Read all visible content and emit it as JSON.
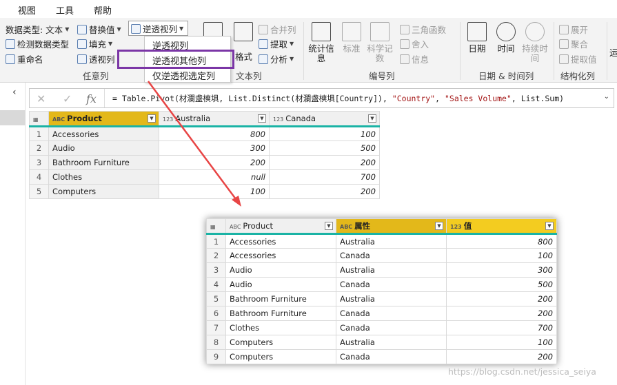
{
  "menubar": {
    "items": [
      "视图",
      "工具",
      "帮助"
    ]
  },
  "ribbon": {
    "datatype_label": "数据类型: 文本",
    "detect_label": "检测数据类型",
    "rename_label": "重命名",
    "replace_label": "替换值",
    "fill_label": "填充",
    "pivot_label": "透视列",
    "unpivot_label": "逆透视列",
    "any_column_group": "任意列",
    "merge_label": "合并列",
    "extract_label": "提取",
    "parse_label": "分析",
    "text_group": "文本列",
    "format_label": "格式",
    "stats_label": "统计信息",
    "standard_label": "标准",
    "science_label": "科学记数",
    "trig_label": "三角函数",
    "round_label": "舍入",
    "info_label": "信息",
    "number_group": "编号列",
    "date_label": "日期",
    "time_label": "时间",
    "duration_label": "持续时间",
    "datetime_group": "日期 & 时间列",
    "expand_label": "展开",
    "aggregate_label": "聚合",
    "extract_values_label": "提取值",
    "structured_group": "结构化列",
    "last_cut_label": "运"
  },
  "dropdown": {
    "items": [
      "逆透视列",
      "逆透视其他列",
      "仅逆透视选定列"
    ]
  },
  "formula": {
    "prefix": "= Table.Pivot(材瀾盏樉埧, List.Distinct(材瀾盏樉埧[Country]), ",
    "str1": "\"Country\"",
    "mid": ", ",
    "str2": "\"Sales Volume\"",
    "suffix": ", List.Sum)"
  },
  "table1": {
    "headers": [
      "Product",
      "Australia",
      "Canada"
    ],
    "types": [
      "ABC",
      "123",
      "123"
    ],
    "rows": [
      [
        "1",
        "Accessories",
        "800",
        "100"
      ],
      [
        "2",
        "Audio",
        "300",
        "500"
      ],
      [
        "3",
        "Bathroom Furniture",
        "200",
        "200"
      ],
      [
        "4",
        "Clothes",
        "null",
        "700"
      ],
      [
        "5",
        "Computers",
        "100",
        "200"
      ]
    ]
  },
  "table2": {
    "headers": [
      "Product",
      "属性",
      "值"
    ],
    "types": [
      "ABC",
      "ABC",
      "123"
    ],
    "rows": [
      [
        "1",
        "Accessories",
        "Australia",
        "800"
      ],
      [
        "2",
        "Accessories",
        "Canada",
        "100"
      ],
      [
        "3",
        "Audio",
        "Australia",
        "300"
      ],
      [
        "4",
        "Audio",
        "Canada",
        "500"
      ],
      [
        "5",
        "Bathroom Furniture",
        "Australia",
        "200"
      ],
      [
        "6",
        "Bathroom Furniture",
        "Canada",
        "200"
      ],
      [
        "7",
        "Clothes",
        "Canada",
        "700"
      ],
      [
        "8",
        "Computers",
        "Australia",
        "100"
      ],
      [
        "9",
        "Computers",
        "Canada",
        "200"
      ]
    ]
  },
  "watermark": "https://blog.csdn.net/jessica_seiya",
  "colors": {
    "highlight": "#7b36a6",
    "arrow": "#e84545",
    "teal": "#1ab3a5",
    "header_gold": "#e3b81a"
  }
}
